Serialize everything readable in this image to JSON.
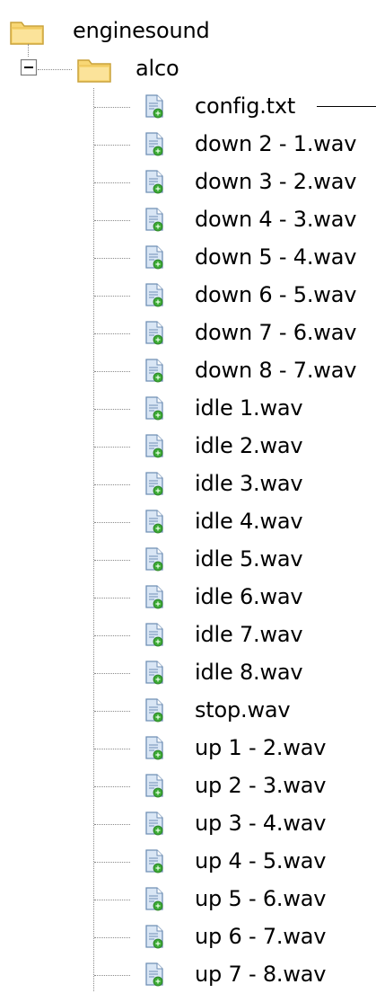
{
  "root": {
    "label": "enginesound",
    "icon": "folder-icon"
  },
  "subfolder": {
    "label": "alco",
    "icon": "folder-icon",
    "expander": "collapse-minus-icon"
  },
  "files": [
    {
      "label": "config.txt",
      "icon": "text-file-icon"
    },
    {
      "label": "down 2 - 1.wav",
      "icon": "audio-file-icon"
    },
    {
      "label": "down 3 - 2.wav",
      "icon": "audio-file-icon"
    },
    {
      "label": "down 4 - 3.wav",
      "icon": "audio-file-icon"
    },
    {
      "label": "down 5 - 4.wav",
      "icon": "audio-file-icon"
    },
    {
      "label": "down 6 - 5.wav",
      "icon": "audio-file-icon"
    },
    {
      "label": "down 7 - 6.wav",
      "icon": "audio-file-icon"
    },
    {
      "label": "down 8 - 7.wav",
      "icon": "audio-file-icon"
    },
    {
      "label": "idle 1.wav",
      "icon": "audio-file-icon"
    },
    {
      "label": "idle 2.wav",
      "icon": "audio-file-icon"
    },
    {
      "label": "idle 3.wav",
      "icon": "audio-file-icon"
    },
    {
      "label": "idle 4.wav",
      "icon": "audio-file-icon"
    },
    {
      "label": "idle 5.wav",
      "icon": "audio-file-icon"
    },
    {
      "label": "idle 6.wav",
      "icon": "audio-file-icon"
    },
    {
      "label": "idle 7.wav",
      "icon": "audio-file-icon"
    },
    {
      "label": "idle 8.wav",
      "icon": "audio-file-icon"
    },
    {
      "label": "stop.wav",
      "icon": "audio-file-icon"
    },
    {
      "label": "up 1 - 2.wav",
      "icon": "audio-file-icon"
    },
    {
      "label": "up 2 - 3.wav",
      "icon": "audio-file-icon"
    },
    {
      "label": "up 3 - 4.wav",
      "icon": "audio-file-icon"
    },
    {
      "label": "up 4 - 5.wav",
      "icon": "audio-file-icon"
    },
    {
      "label": "up 5 - 6.wav",
      "icon": "audio-file-icon"
    },
    {
      "label": "up 6 - 7.wav",
      "icon": "audio-file-icon"
    },
    {
      "label": "up 7 - 8.wav",
      "icon": "audio-file-icon"
    }
  ],
  "colors": {
    "folder_fill": "#F8D775",
    "folder_edge": "#C9A23A",
    "file_page": "#D9E6F5",
    "file_edge": "#6F8FB5",
    "file_badge": "#3BAA35",
    "tree_line": "#8A8A8A",
    "text": "#000000"
  }
}
